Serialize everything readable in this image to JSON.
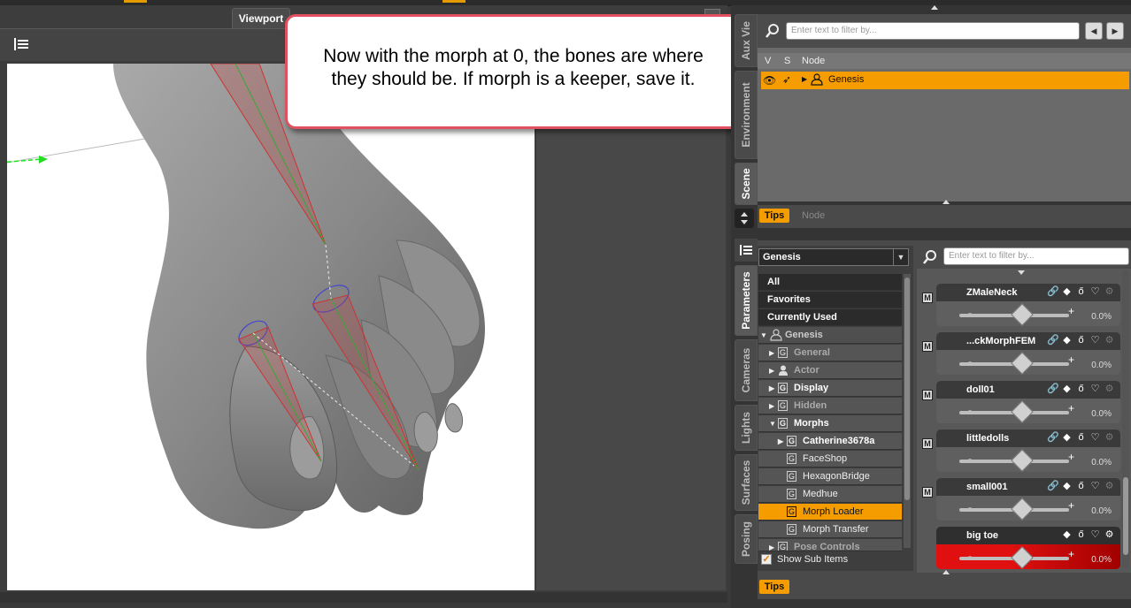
{
  "viewport": {
    "tab_label": "Viewport"
  },
  "callout": {
    "line1": "Now with the morph at 0, the bones are where",
    "line2": "they should be. If morph is a keeper, save it."
  },
  "side_tabs_top": [
    "Aux Vie",
    "Environment",
    "Scene"
  ],
  "side_tabs_bottom": [
    "Parameters",
    "Cameras",
    "Lights",
    "Surfaces",
    "Posing"
  ],
  "scene": {
    "search_placeholder": "Enter text to filter by...",
    "columns": {
      "v": "V",
      "s": "S",
      "node": "Node"
    },
    "row_label": "Genesis",
    "tips_label": "Tips",
    "node_label": "Node"
  },
  "parameters": {
    "selected_figure": "Genesis",
    "search_placeholder": "Enter text to filter by...",
    "categories": [
      "All",
      "Favorites",
      "Currently Used"
    ],
    "tree": {
      "root": "Genesis",
      "general": "General",
      "actor": "Actor",
      "display": "Display",
      "hidden": "Hidden",
      "morphs": "Morphs",
      "catherine": "Catherine3678a",
      "faceshop": "FaceShop",
      "hexagon": "HexagonBridge",
      "medhue": "Medhue",
      "morph_loader": "Morph Loader",
      "morph_transfer": "Morph Transfer",
      "pose_controls": "Pose Controls"
    },
    "show_sub_items": "Show Sub Items",
    "tips_label": "Tips",
    "sliders": [
      {
        "name": "ZMaleNeck",
        "value": "0.0%",
        "m": "M"
      },
      {
        "name": "...ckMorphFEM",
        "value": "0.0%",
        "m": "M"
      },
      {
        "name": "doll01",
        "value": "0.0%",
        "m": "M"
      },
      {
        "name": "littledolls",
        "value": "0.0%",
        "m": "M"
      },
      {
        "name": "small001",
        "value": "0.0%",
        "m": "M"
      },
      {
        "name": "big toe",
        "value": "0.0%"
      }
    ],
    "slider_minus": "-",
    "slider_plus": "+"
  },
  "colors": {
    "accent": "#f59d00",
    "callout_border": "#e0505f",
    "highlight_slider": "#e01010"
  }
}
